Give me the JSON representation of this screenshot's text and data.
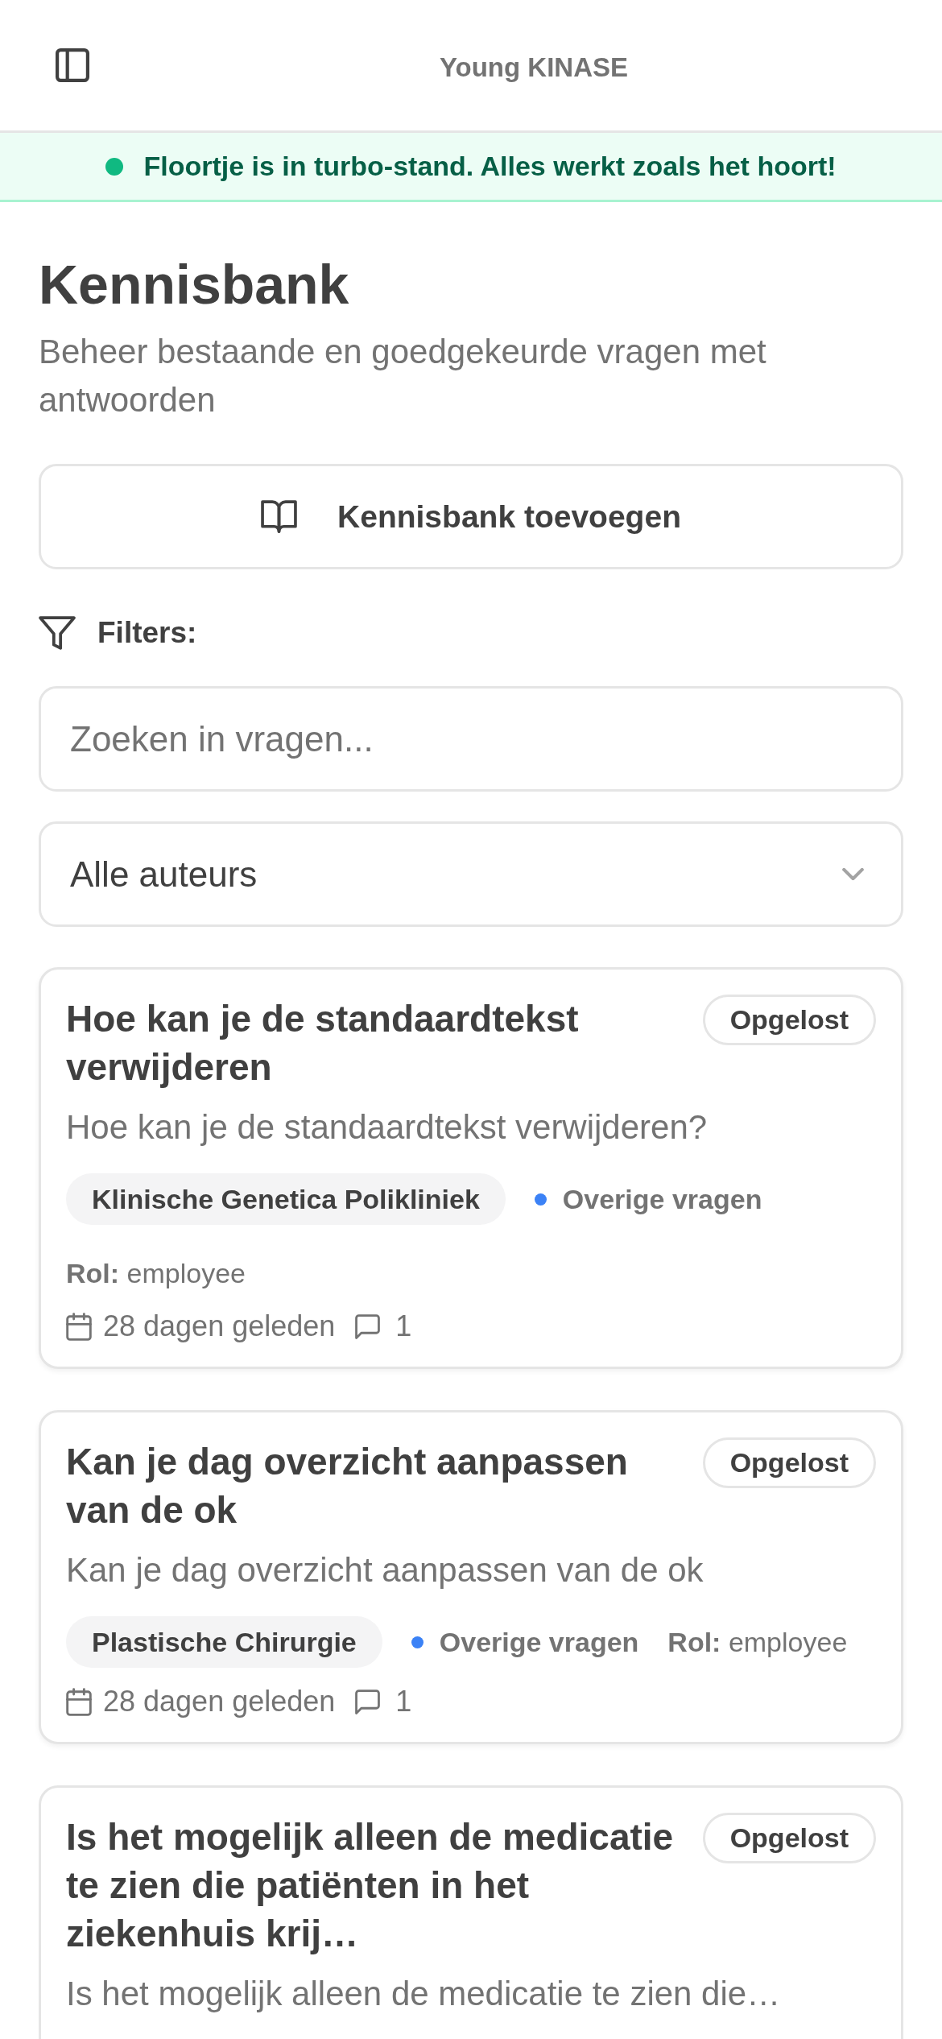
{
  "header": {
    "title": "Young KINASE"
  },
  "status_banner": {
    "message": "Floortje is in turbo-stand. Alles werkt zoals het hoort!"
  },
  "page": {
    "title": "Kennisbank",
    "subtitle": "Beheer bestaande en goedgekeurde vragen met antwoorden"
  },
  "add_button": {
    "label": "Kennisbank toevoegen"
  },
  "filters": {
    "label": "Filters:",
    "search": {
      "placeholder": "Zoeken in vragen..."
    },
    "author_select": {
      "value": "Alle auteurs"
    }
  },
  "questions": [
    {
      "title": "Hoe kan je de standaardtekst verwijderen",
      "status": "Opgelost",
      "description": "Hoe kan je de standaardtekst verwijderen?",
      "department": "Klinische Genetica Polikliniek",
      "category": {
        "label": "Overige vragen",
        "color": "#3b82f6"
      },
      "role": "**Rol:** employee",
      "date": "28 dagen geleden",
      "comments": "1"
    },
    {
      "title": "Kan je dag overzicht aanpassen van de ok",
      "status": "Opgelost",
      "description": "Kan je dag overzicht aanpassen van de ok",
      "department": "Plastische Chirurgie",
      "category": {
        "label": "Overige vragen",
        "color": "#3b82f6"
      },
      "role": "**Rol:** employee",
      "date": "28 dagen geleden",
      "comments": "1"
    },
    {
      "title": "Is het mogelijk alleen de medicatie te zien die patiënten in het ziekenhuis krij…",
      "status": "Opgelost",
      "description": "Is het mogelijk alleen de medicatie te zien die…"
    }
  ]
}
